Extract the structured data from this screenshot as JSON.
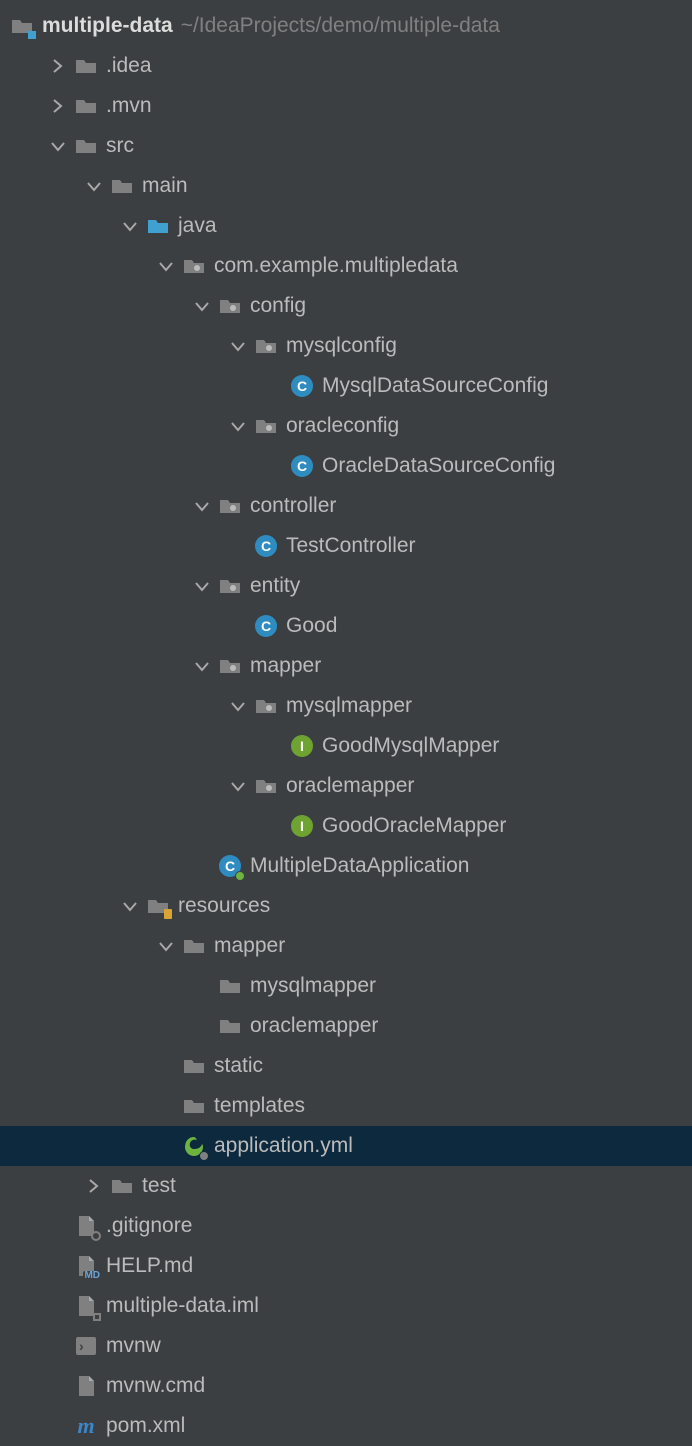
{
  "root": {
    "name": "multiple-data",
    "path": "~/IdeaProjects/demo/multiple-data"
  },
  "nodes": {
    "idea": ".idea",
    "mvn": ".mvn",
    "src": "src",
    "main": "main",
    "java": "java",
    "pkg": "com.example.multipledata",
    "config": "config",
    "mysqlconfig": "mysqlconfig",
    "mysqlDsConfig": "MysqlDataSourceConfig",
    "oracleconfig": "oracleconfig",
    "oracleDsConfig": "OracleDataSourceConfig",
    "controller": "controller",
    "testController": "TestController",
    "entity": "entity",
    "good": "Good",
    "mapper": "mapper",
    "mysqlmapper": "mysqlmapper",
    "goodMysqlMapper": "GoodMysqlMapper",
    "oraclemapper": "oraclemapper",
    "goodOracleMapper": "GoodOracleMapper",
    "multipleDataApp": "MultipleDataApplication",
    "resources": "resources",
    "resMapper": "mapper",
    "resMysqlMapper": "mysqlmapper",
    "resOracleMapper": "oraclemapper",
    "static": "static",
    "templates": "templates",
    "appYml": "application.yml",
    "test": "test",
    "gitignore": ".gitignore",
    "helpmd": "HELP.md",
    "iml": "multiple-data.iml",
    "mvnw": "mvnw",
    "mvnwcmd": "mvnw.cmd",
    "pom": "pom.xml"
  }
}
